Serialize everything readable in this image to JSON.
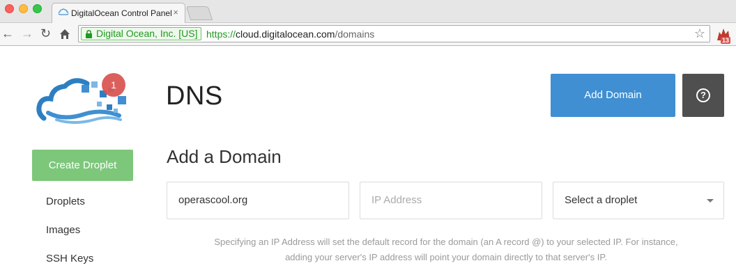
{
  "browser": {
    "tab_title": "DigitalOcean Control Panel",
    "tab_close": "×",
    "ev_label": "Digital Ocean, Inc. [US]",
    "url_scheme": "https://",
    "url_host": "cloud.digitalocean.com",
    "url_path": "/domains",
    "extension_badge": "13"
  },
  "sidebar": {
    "notification_count": "1",
    "create_button": "Create Droplet",
    "items": [
      {
        "label": "Droplets"
      },
      {
        "label": "Images"
      },
      {
        "label": "SSH Keys"
      }
    ]
  },
  "header": {
    "title": "DNS",
    "add_domain_button": "Add Domain",
    "help_symbol": "?"
  },
  "form": {
    "heading": "Add a Domain",
    "domain_value": "operascool.org",
    "ip_placeholder": "IP Address",
    "droplet_select": "Select a droplet",
    "help_text": "Specifying an IP Address will set the default record for the domain (an A record @) to your selected IP. For instance, adding your server's IP address will point your domain directly to that server's IP."
  },
  "colors": {
    "primary": "#3f8fd2",
    "create": "#7dc77b",
    "badge": "#d9534f",
    "dark_button": "#4f4f4f"
  }
}
